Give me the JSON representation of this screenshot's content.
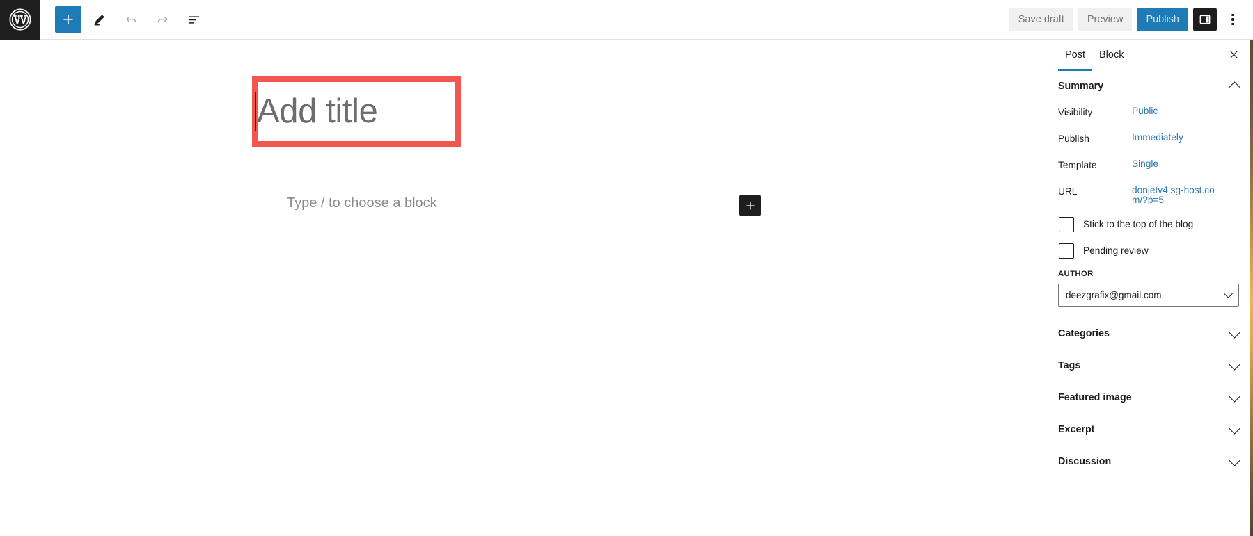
{
  "header": {
    "logo_icon": "wordpress-logo-icon",
    "left_tools": [
      {
        "name": "block-inserter-toggle",
        "icon": "plus-icon",
        "label": "Toggle block inserter",
        "state": "active"
      },
      {
        "name": "tools-pencil",
        "icon": "pencil-icon",
        "label": "Tools",
        "state": "enabled"
      },
      {
        "name": "undo",
        "icon": "undo-arrow-icon",
        "label": "Undo",
        "state": "disabled"
      },
      {
        "name": "redo",
        "icon": "redo-arrow-icon",
        "label": "Redo",
        "state": "disabled"
      },
      {
        "name": "document-overview",
        "icon": "list-view-icon",
        "label": "Document Overview",
        "state": "enabled"
      }
    ],
    "save_draft_label": "Save draft",
    "preview_label": "Preview",
    "publish_label": "Publish",
    "settings_toggle_icon": "sidebar-panel-icon",
    "options_icon": "kebab-menu-icon",
    "accent_blue": "#1e7bb5"
  },
  "editor": {
    "title_placeholder": "Add title",
    "block_prompt": "Type / to choose a block",
    "inserter_icon": "plus-icon",
    "highlight_color": "#f1564f"
  },
  "sidebar": {
    "tabs": [
      {
        "label": "Post",
        "active": true
      },
      {
        "label": "Block",
        "active": false
      }
    ],
    "close_icon": "close-x-icon",
    "summary": {
      "title": "Summary",
      "expanded": true,
      "collapse_icon": "chevron-up-icon",
      "rows": [
        {
          "label": "Visibility",
          "value": "Public"
        },
        {
          "label": "Publish",
          "value": "Immediately"
        },
        {
          "label": "Template",
          "value": "Single"
        },
        {
          "label": "URL",
          "value": "donjetv4.sg-host.com/?p=5"
        }
      ],
      "checkboxes": [
        {
          "label": "Stick to the top of the blog",
          "checked": false
        },
        {
          "label": "Pending review",
          "checked": false
        }
      ],
      "author_label": "AUTHOR",
      "author_value": "deezgrafix@gmail.com",
      "author_chevron_icon": "chevron-down-icon"
    },
    "panels": [
      {
        "label": "Categories",
        "expanded": false,
        "icon": "chevron-down-icon"
      },
      {
        "label": "Tags",
        "expanded": false,
        "icon": "chevron-down-icon"
      },
      {
        "label": "Featured image",
        "expanded": false,
        "icon": "chevron-down-icon"
      },
      {
        "label": "Excerpt",
        "expanded": false,
        "icon": "chevron-down-icon"
      },
      {
        "label": "Discussion",
        "expanded": false,
        "icon": "chevron-down-icon"
      }
    ]
  }
}
